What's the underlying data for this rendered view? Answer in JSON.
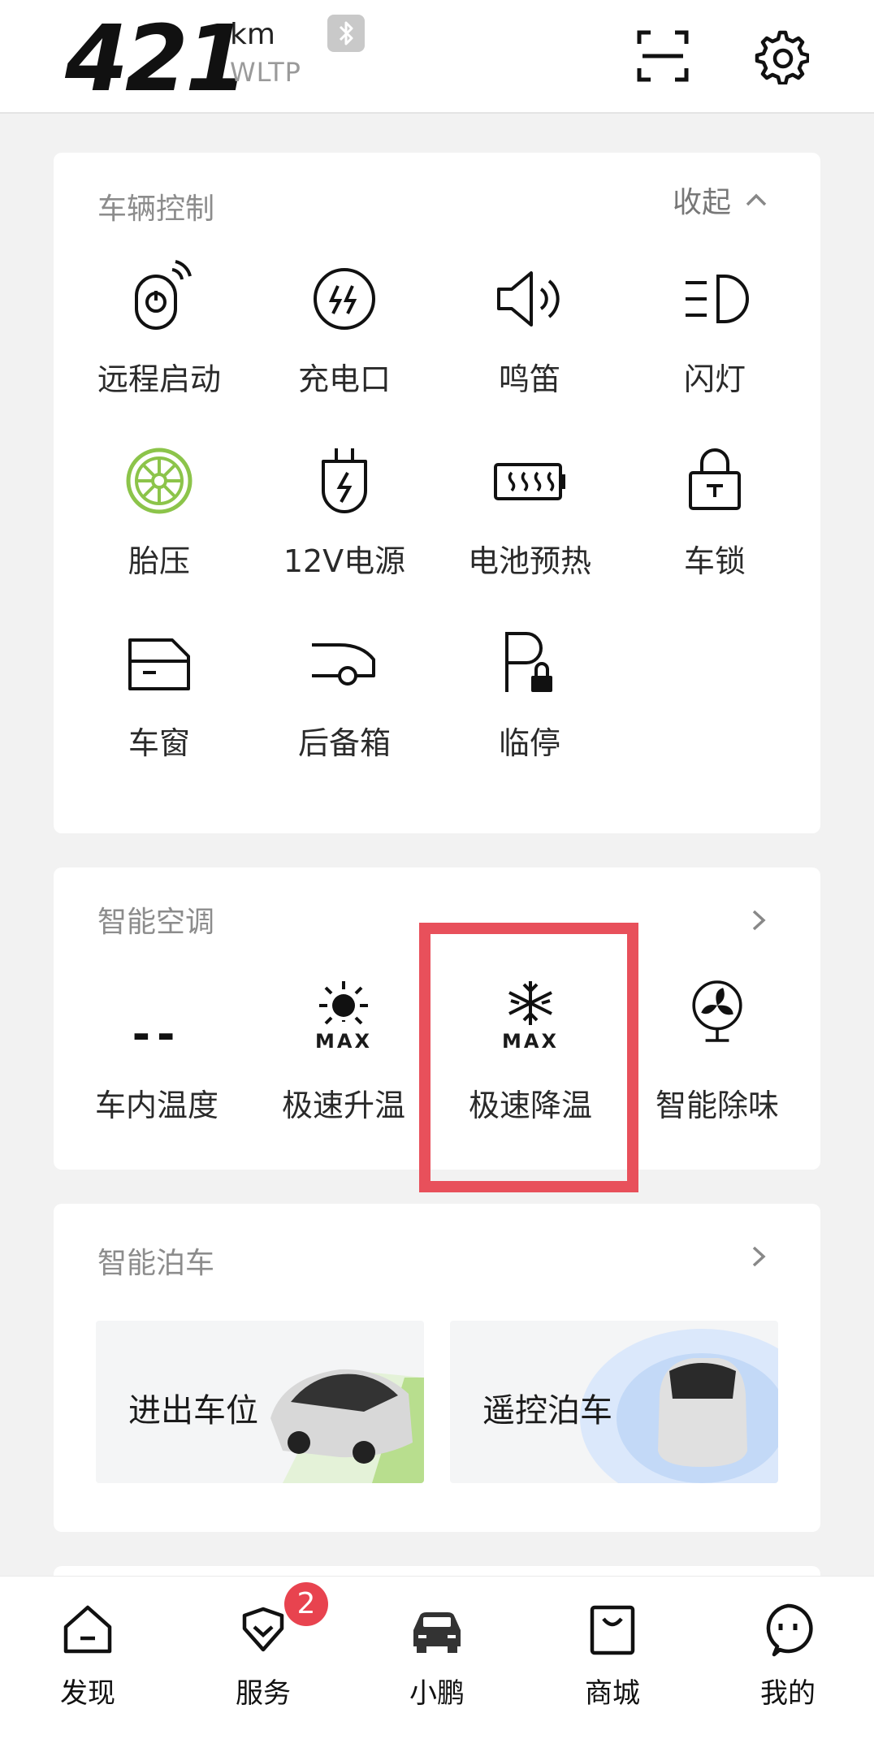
{
  "header": {
    "range_value": "421",
    "range_unit": "km",
    "range_standard": "WLTP",
    "bluetooth_icon": "bluetooth-icon",
    "scan_icon": "scan-icon",
    "settings_icon": "gear-icon"
  },
  "vehicle_control": {
    "title": "车辆控制",
    "collapse_label": "收起",
    "items": [
      {
        "label": "远程启动",
        "icon": "remote-start-icon"
      },
      {
        "label": "充电口",
        "icon": "charge-port-icon"
      },
      {
        "label": "鸣笛",
        "icon": "horn-icon"
      },
      {
        "label": "闪灯",
        "icon": "flash-lights-icon"
      },
      {
        "label": "胎压",
        "icon": "tire-pressure-icon"
      },
      {
        "label": "12V电源",
        "icon": "12v-power-icon"
      },
      {
        "label": "电池预热",
        "icon": "battery-preheat-icon"
      },
      {
        "label": "车锁",
        "icon": "lock-icon"
      },
      {
        "label": "车窗",
        "icon": "window-icon"
      },
      {
        "label": "后备箱",
        "icon": "trunk-icon"
      },
      {
        "label": "临停",
        "icon": "temporary-parking-icon"
      }
    ]
  },
  "climate": {
    "title": "智能空调",
    "items": [
      {
        "label": "车内温度",
        "value": "--"
      },
      {
        "label": "极速升温",
        "icon": "max-heat-icon",
        "icon_text": "MAX"
      },
      {
        "label": "极速降温",
        "icon": "max-cool-icon",
        "icon_text": "MAX"
      },
      {
        "label": "智能除味",
        "icon": "fan-icon"
      }
    ],
    "highlight_color": "#e8505b"
  },
  "parking": {
    "title": "智能泊车",
    "items": [
      {
        "label": "进出车位"
      },
      {
        "label": "遥控泊车"
      }
    ]
  },
  "nav": {
    "items": [
      {
        "label": "发现",
        "icon": "home-icon"
      },
      {
        "label": "服务",
        "icon": "service-icon",
        "badge": "2"
      },
      {
        "label": "小鹏",
        "icon": "car-icon"
      },
      {
        "label": "商城",
        "icon": "shop-bag-icon"
      },
      {
        "label": "我的",
        "icon": "profile-icon"
      }
    ]
  },
  "colors": {
    "background": "#f2f2f2",
    "card": "#ffffff",
    "tire_green": "#8cc44a",
    "badge_red": "#e8434f"
  }
}
